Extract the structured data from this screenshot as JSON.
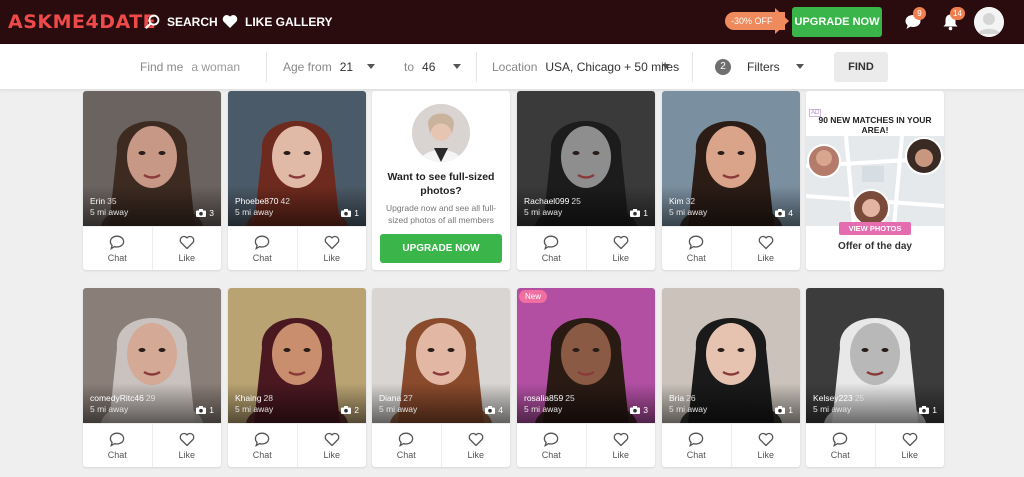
{
  "header": {
    "logo": "ASKME4DATE",
    "search_label": "SEARCH",
    "gallery_label": "LIKE GALLERY",
    "promo": "-30% OFF",
    "upgrade_label": "UPGRADE NOW",
    "messages_count": "9",
    "notifications_count": "14"
  },
  "filters": {
    "find_me_label": "Find me",
    "find_me_value": "a woman",
    "age_from_label": "Age from",
    "age_from_value": "21",
    "age_to_label": "to",
    "age_to_value": "46",
    "location_label": "Location",
    "location_value": "USA, Chicago + 50 miles",
    "filters_count": "2",
    "filters_label": "Filters",
    "find_button": "FIND"
  },
  "actions": {
    "chat": "Chat",
    "like": "Like"
  },
  "profiles": [
    {
      "name": "Erin",
      "age": "35",
      "distance": "5 mi away",
      "photos": "3",
      "new": false,
      "bg": "#6b6360",
      "skin": "#c89886",
      "hair": "#3d2b22"
    },
    {
      "name": "Phoebe870",
      "age": "42",
      "distance": "5 mi away",
      "photos": "1",
      "new": false,
      "bg": "#4b5a68",
      "skin": "#e0b9a7",
      "hair": "#6e2a1e"
    },
    {
      "name": "Rachael099",
      "age": "25",
      "distance": "5 mi away",
      "photos": "1",
      "new": false,
      "bg": "#3a3a3a",
      "skin": "#8e8e8e",
      "hair": "#1c1c1c"
    },
    {
      "name": "Kim",
      "age": "32",
      "distance": "5 mi away",
      "photos": "4",
      "new": false,
      "bg": "#7a8fa0",
      "skin": "#d9a48a",
      "hair": "#2b1c16"
    },
    {
      "name": "comedyRitc46",
      "age": "29",
      "distance": "5 mi away",
      "photos": "1",
      "new": false,
      "bg": "#8a7e78",
      "skin": "#d4a996",
      "hair": "#c9c2be"
    },
    {
      "name": "Khaing",
      "age": "28",
      "distance": "5 mi away",
      "photos": "2",
      "new": false,
      "bg": "#b9a372",
      "skin": "#c98e6e",
      "hair": "#4a1820"
    },
    {
      "name": "Diana",
      "age": "27",
      "distance": "5 mi away",
      "photos": "4",
      "new": false,
      "bg": "#d8d5d2",
      "skin": "#e2b7a3",
      "hair": "#8a4a2c"
    },
    {
      "name": "rosalia859",
      "age": "25",
      "distance": "5 mi away",
      "photos": "3",
      "new": true,
      "new_label": "New",
      "bg": "#b24fa3",
      "skin": "#8a5a44",
      "hair": "#2a1a14"
    },
    {
      "name": "Bria",
      "age": "26",
      "distance": "5 mi away",
      "photos": "1",
      "new": false,
      "bg": "#cbc3bb",
      "skin": "#e6c3b0",
      "hair": "#1a1a1a"
    },
    {
      "name": "Kelsey223",
      "age": "25",
      "distance": "5 mi away",
      "photos": "1",
      "new": false,
      "bg": "#3c3c3c",
      "skin": "#b8b8b8",
      "hair": "#e8e8e8"
    }
  ],
  "promo_card": {
    "title": "Want to see full-sized photos?",
    "subtitle": "Upgrade now and see all full-sized photos of all members",
    "button": "UPGRADE NOW"
  },
  "offer_card": {
    "ad_label": "AD",
    "headline": "90 NEW MATCHES IN YOUR AREA!",
    "button": "VIEW PHOTOS",
    "footer": "Offer of the day"
  },
  "colors": {
    "accent": "#ef4a4a",
    "nav_bg": "#2a0b0e",
    "upgrade": "#3ab54a",
    "badge": "#f07f4f"
  }
}
